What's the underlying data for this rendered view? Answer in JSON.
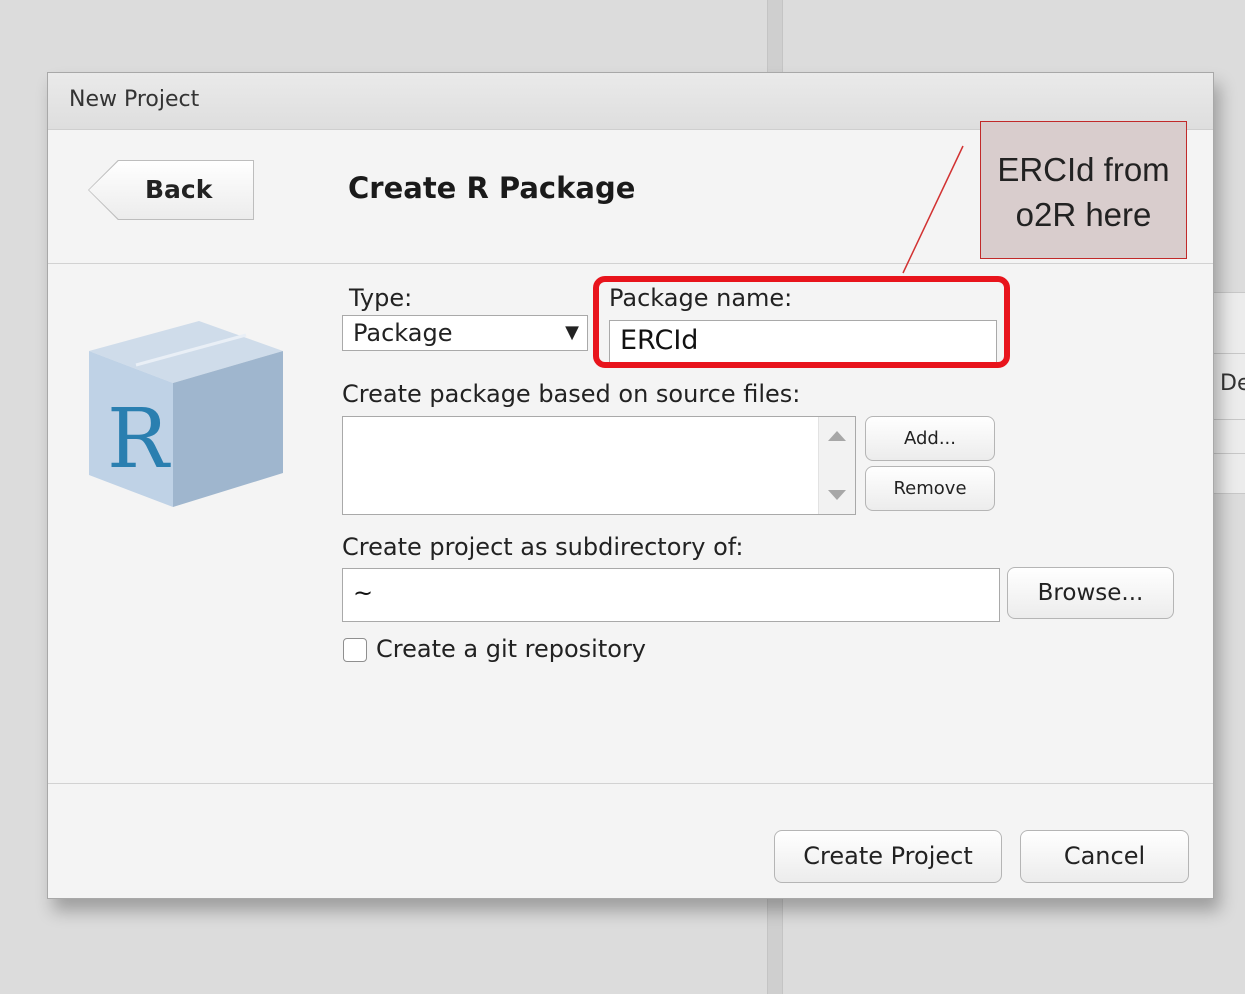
{
  "dialog": {
    "title": "New Project",
    "back_label": "Back",
    "page_title": "Create R Package",
    "type": {
      "label": "Type:",
      "selected": "Package"
    },
    "package_name": {
      "label": "Package name:",
      "value": "ERCId"
    },
    "source_files": {
      "label": "Create package based on source files:",
      "add_label": "Add...",
      "remove_label": "Remove"
    },
    "subdirectory": {
      "label": "Create project as subdirectory of:",
      "value": "~",
      "browse_label": "Browse..."
    },
    "git": {
      "label": "Create a git repository",
      "checked": false
    },
    "footer": {
      "create_label": "Create Project",
      "cancel_label": "Cancel"
    }
  },
  "background": {
    "fragment": "De"
  },
  "callout": {
    "line1": "ERCId from",
    "line2": "o2R here"
  },
  "colors": {
    "highlight": "#e8141c",
    "callout_fill": "#d9cdcd",
    "callout_border": "#c12a2a"
  },
  "icons": {
    "app": "r-package-box-icon"
  }
}
